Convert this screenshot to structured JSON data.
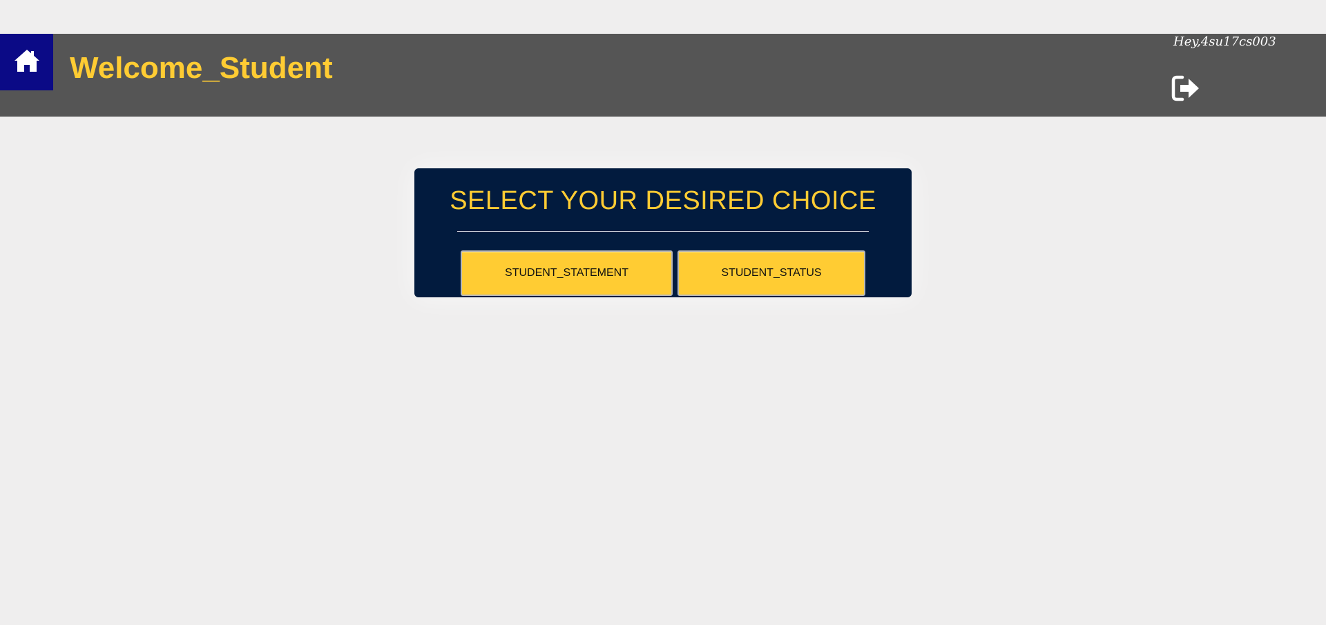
{
  "header": {
    "title": "Welcome_Student",
    "greeting": "Hey,4su17cs003",
    "home_icon": "home-icon",
    "logout_icon": "sign-out-icon"
  },
  "panel": {
    "title": "SELECT YOUR DESIRED CHOICE",
    "buttons": [
      {
        "label": "STUDENT_STATEMENT"
      },
      {
        "label": "STUDENT_STATUS"
      }
    ]
  },
  "colors": {
    "background": "#efeeee",
    "header": "#555555",
    "home_button": "#0b0a86",
    "accent": "#ffcc33",
    "panel": "#021b3e"
  }
}
